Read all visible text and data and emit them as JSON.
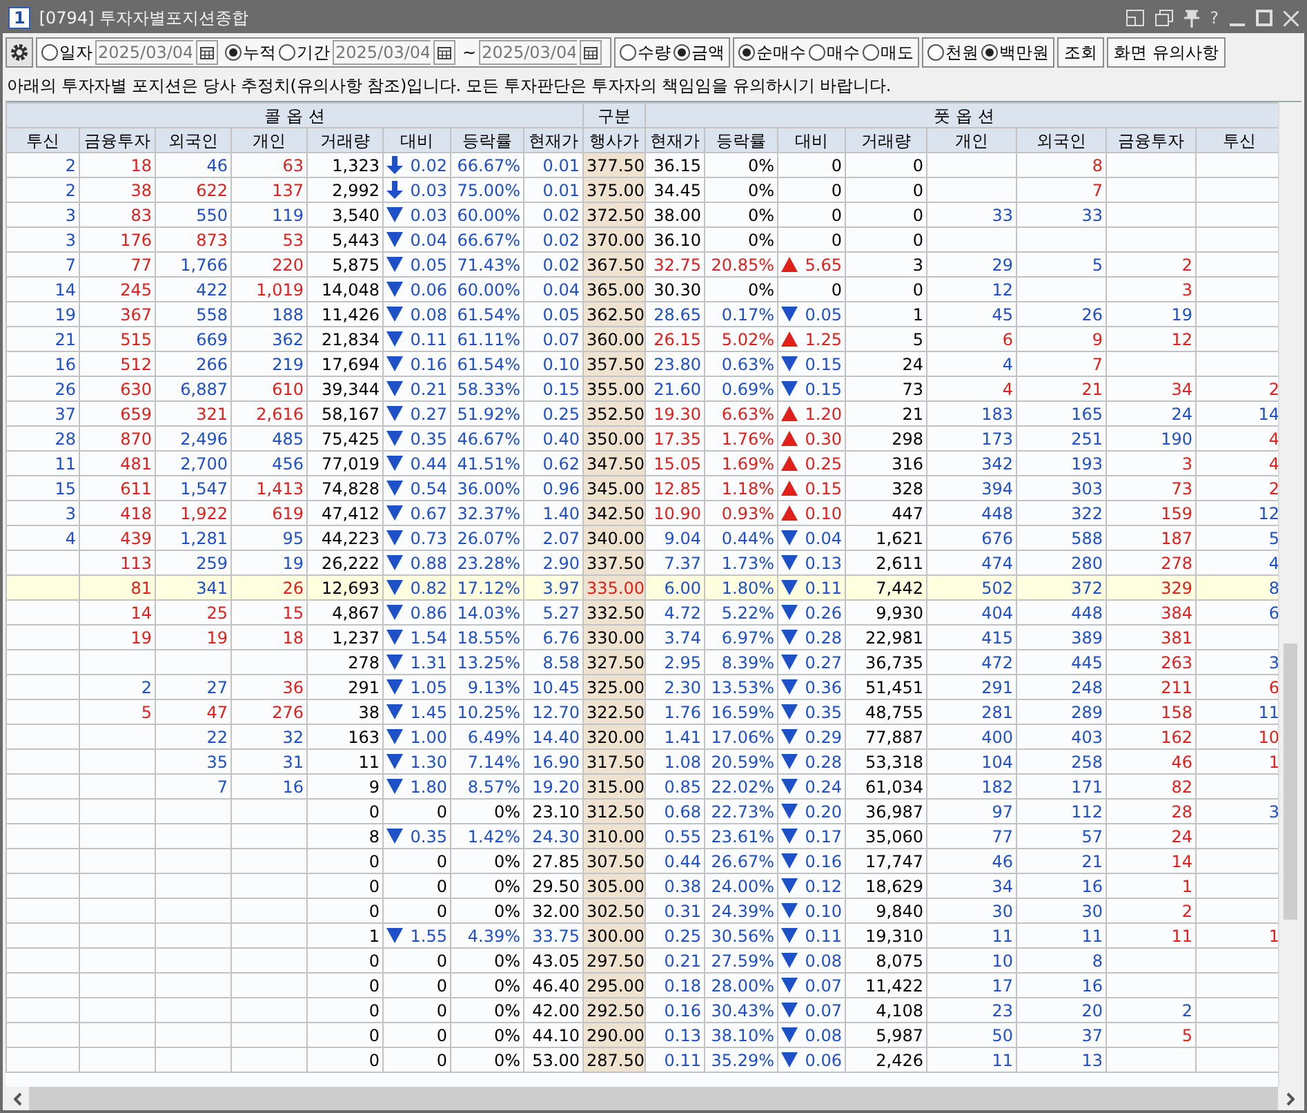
{
  "window": {
    "badge": "1",
    "title": "[0794] 투자자별포지션종합",
    "help": "?"
  },
  "toolbar": {
    "groups": [
      {
        "items": [
          {
            "kind": "radio",
            "label": "일자",
            "selected": false
          },
          {
            "kind": "date",
            "value": "2025/03/04"
          },
          {
            "kind": "radio",
            "label": "누적",
            "selected": true
          },
          {
            "kind": "radio",
            "label": "기간",
            "selected": false
          },
          {
            "kind": "date",
            "value": "2025/03/04"
          },
          {
            "kind": "text",
            "label": "~"
          },
          {
            "kind": "date",
            "value": "2025/03/04"
          }
        ]
      },
      {
        "items": [
          {
            "kind": "radio",
            "label": "수량",
            "selected": false
          },
          {
            "kind": "radio",
            "label": "금액",
            "selected": true
          }
        ]
      },
      {
        "items": [
          {
            "kind": "radio",
            "label": "순매수",
            "selected": true
          },
          {
            "kind": "radio",
            "label": "매수",
            "selected": false
          },
          {
            "kind": "radio",
            "label": "매도",
            "selected": false
          }
        ]
      },
      {
        "items": [
          {
            "kind": "radio",
            "label": "천원",
            "selected": false
          },
          {
            "kind": "radio",
            "label": "백만원",
            "selected": true
          }
        ]
      }
    ],
    "buttons": [
      "조회",
      "화면 유의사항"
    ]
  },
  "notice": "아래의 투자자별 포지션은 당사 추정치(유의사항 참조)입니다. 모든 투자판단은 투자자의 책임임을 유의하시기 바랍니다.",
  "table": {
    "groups": [
      "콜 옵 션",
      "구분",
      "풋 옵 션"
    ],
    "call_columns": [
      "투신",
      "금융투자",
      "외국인",
      "개인",
      "거래량",
      "대비",
      "등락률",
      "현재가"
    ],
    "strike_column": "행사가",
    "put_columns": [
      "현재가",
      "등락률",
      "대비",
      "거래량",
      "개인",
      "외국인",
      "금융투자",
      "투신"
    ],
    "rows": [
      {
        "strike": "377.50",
        "selected": false,
        "call": {
          "inv_trust": {
            "text": "2",
            "net_buy": false
          },
          "fin_invest": {
            "text": "18",
            "net_buy": true
          },
          "foreign": {
            "text": "46",
            "net_buy": false
          },
          "individual": {
            "text": "63",
            "net_buy": true
          },
          "volume": "1,323",
          "change": {
            "text": "0.02",
            "kind": "limit_down"
          },
          "change_rate": "66.67%",
          "price": "0.01"
        },
        "put": {
          "price": "36.15",
          "change_rate": "0%",
          "change": {
            "text": "0",
            "kind": "flat"
          },
          "volume": "0",
          "foreign": {
            "text": "8",
            "net_buy": true
          }
        }
      },
      {
        "strike": "375.00",
        "selected": false,
        "call": {
          "inv_trust": {
            "text": "2",
            "net_buy": false
          },
          "fin_invest": {
            "text": "38",
            "net_buy": true
          },
          "foreign": {
            "text": "622",
            "net_buy": true
          },
          "individual": {
            "text": "137",
            "net_buy": true
          },
          "volume": "2,992",
          "change": {
            "text": "0.03",
            "kind": "limit_down"
          },
          "change_rate": "75.00%",
          "price": "0.01"
        },
        "put": {
          "price": "34.45",
          "change_rate": "0%",
          "change": {
            "text": "0",
            "kind": "flat"
          },
          "volume": "0",
          "foreign": {
            "text": "7",
            "net_buy": true
          }
        }
      },
      {
        "strike": "372.50",
        "selected": false,
        "call": {
          "inv_trust": {
            "text": "3",
            "net_buy": false
          },
          "fin_invest": {
            "text": "83",
            "net_buy": true
          },
          "foreign": {
            "text": "550",
            "net_buy": false
          },
          "individual": {
            "text": "119",
            "net_buy": false
          },
          "volume": "3,540",
          "change": {
            "text": "0.03",
            "kind": "down"
          },
          "change_rate": "60.00%",
          "price": "0.02"
        },
        "put": {
          "price": "38.00",
          "change_rate": "0%",
          "change": {
            "text": "0",
            "kind": "flat"
          },
          "volume": "0",
          "individual": {
            "text": "33",
            "net_buy": false
          },
          "foreign": {
            "text": "33",
            "net_buy": false
          }
        }
      },
      {
        "strike": "370.00",
        "selected": false,
        "call": {
          "inv_trust": {
            "text": "3",
            "net_buy": false
          },
          "fin_invest": {
            "text": "176",
            "net_buy": true
          },
          "foreign": {
            "text": "873",
            "net_buy": true
          },
          "individual": {
            "text": "53",
            "net_buy": true
          },
          "volume": "5,443",
          "change": {
            "text": "0.04",
            "kind": "down"
          },
          "change_rate": "66.67%",
          "price": "0.02"
        },
        "put": {
          "price": "36.10",
          "change_rate": "0%",
          "change": {
            "text": "0",
            "kind": "flat"
          },
          "volume": "0"
        }
      },
      {
        "strike": "367.50",
        "selected": false,
        "call": {
          "inv_trust": {
            "text": "7",
            "net_buy": false
          },
          "fin_invest": {
            "text": "77",
            "net_buy": true
          },
          "foreign": {
            "text": "1,766",
            "net_buy": false
          },
          "individual": {
            "text": "220",
            "net_buy": true
          },
          "volume": "5,875",
          "change": {
            "text": "0.05",
            "kind": "down"
          },
          "change_rate": "71.43%",
          "price": "0.02"
        },
        "put": {
          "price": "32.75",
          "change_rate": "20.85%",
          "change": {
            "text": "5.65",
            "kind": "up"
          },
          "volume": "3",
          "individual": {
            "text": "29",
            "net_buy": false
          },
          "foreign": {
            "text": "5",
            "net_buy": false
          },
          "fin_invest": {
            "text": "2",
            "net_buy": true
          }
        }
      },
      {
        "strike": "365.00",
        "selected": false,
        "call": {
          "inv_trust": {
            "text": "14",
            "net_buy": false
          },
          "fin_invest": {
            "text": "245",
            "net_buy": true
          },
          "foreign": {
            "text": "422",
            "net_buy": false
          },
          "individual": {
            "text": "1,019",
            "net_buy": true
          },
          "volume": "14,048",
          "change": {
            "text": "0.06",
            "kind": "down"
          },
          "change_rate": "60.00%",
          "price": "0.04"
        },
        "put": {
          "price": "30.30",
          "change_rate": "0%",
          "change": {
            "text": "0",
            "kind": "flat"
          },
          "volume": "0",
          "individual": {
            "text": "12",
            "net_buy": false
          },
          "fin_invest": {
            "text": "3",
            "net_buy": true
          }
        }
      },
      {
        "strike": "362.50",
        "selected": false,
        "call": {
          "inv_trust": {
            "text": "19",
            "net_buy": false
          },
          "fin_invest": {
            "text": "367",
            "net_buy": true
          },
          "foreign": {
            "text": "558",
            "net_buy": false
          },
          "individual": {
            "text": "188",
            "net_buy": false
          },
          "volume": "11,426",
          "change": {
            "text": "0.08",
            "kind": "down"
          },
          "change_rate": "61.54%",
          "price": "0.05"
        },
        "put": {
          "price": "28.65",
          "change_rate": "0.17%",
          "change": {
            "text": "0.05",
            "kind": "down"
          },
          "volume": "1",
          "individual": {
            "text": "45",
            "net_buy": false
          },
          "foreign": {
            "text": "26",
            "net_buy": false
          },
          "fin_invest": {
            "text": "19",
            "net_buy": false
          }
        }
      },
      {
        "strike": "360.00",
        "selected": false,
        "call": {
          "inv_trust": {
            "text": "21",
            "net_buy": false
          },
          "fin_invest": {
            "text": "515",
            "net_buy": true
          },
          "foreign": {
            "text": "669",
            "net_buy": false
          },
          "individual": {
            "text": "362",
            "net_buy": false
          },
          "volume": "21,834",
          "change": {
            "text": "0.11",
            "kind": "down"
          },
          "change_rate": "61.11%",
          "price": "0.07"
        },
        "put": {
          "price": "26.15",
          "change_rate": "5.02%",
          "change": {
            "text": "1.25",
            "kind": "up"
          },
          "volume": "5",
          "individual": {
            "text": "6",
            "net_buy": true
          },
          "foreign": {
            "text": "9",
            "net_buy": true
          },
          "fin_invest": {
            "text": "12",
            "net_buy": true
          }
        }
      },
      {
        "strike": "357.50",
        "selected": false,
        "call": {
          "inv_trust": {
            "text": "16",
            "net_buy": false
          },
          "fin_invest": {
            "text": "512",
            "net_buy": true
          },
          "foreign": {
            "text": "266",
            "net_buy": false
          },
          "individual": {
            "text": "219",
            "net_buy": false
          },
          "volume": "17,694",
          "change": {
            "text": "0.16",
            "kind": "down"
          },
          "change_rate": "61.54%",
          "price": "0.10"
        },
        "put": {
          "price": "23.80",
          "change_rate": "0.63%",
          "change": {
            "text": "0.15",
            "kind": "down"
          },
          "volume": "24",
          "individual": {
            "text": "4",
            "net_buy": false
          },
          "foreign": {
            "text": "7",
            "net_buy": true
          }
        }
      },
      {
        "strike": "355.00",
        "selected": false,
        "call": {
          "inv_trust": {
            "text": "26",
            "net_buy": false
          },
          "fin_invest": {
            "text": "630",
            "net_buy": true
          },
          "foreign": {
            "text": "6,887",
            "net_buy": false
          },
          "individual": {
            "text": "610",
            "net_buy": true
          },
          "volume": "39,344",
          "change": {
            "text": "0.21",
            "kind": "down"
          },
          "change_rate": "58.33%",
          "price": "0.15"
        },
        "put": {
          "price": "21.60",
          "change_rate": "0.69%",
          "change": {
            "text": "0.15",
            "kind": "down"
          },
          "volume": "73",
          "individual": {
            "text": "4",
            "net_buy": true
          },
          "foreign": {
            "text": "21",
            "net_buy": true
          },
          "fin_invest": {
            "text": "34",
            "net_buy": true
          },
          "inv_trust": {
            "text": "2",
            "net_buy": true
          }
        }
      },
      {
        "strike": "352.50",
        "selected": false,
        "call": {
          "inv_trust": {
            "text": "37",
            "net_buy": false
          },
          "fin_invest": {
            "text": "659",
            "net_buy": true
          },
          "foreign": {
            "text": "321",
            "net_buy": true
          },
          "individual": {
            "text": "2,616",
            "net_buy": true
          },
          "volume": "58,167",
          "change": {
            "text": "0.27",
            "kind": "down"
          },
          "change_rate": "51.92%",
          "price": "0.25"
        },
        "put": {
          "price": "19.30",
          "change_rate": "6.63%",
          "change": {
            "text": "1.20",
            "kind": "up"
          },
          "volume": "21",
          "individual": {
            "text": "183",
            "net_buy": false
          },
          "foreign": {
            "text": "165",
            "net_buy": false
          },
          "fin_invest": {
            "text": "24",
            "net_buy": false
          },
          "inv_trust": {
            "text": "14",
            "net_buy": false
          }
        }
      },
      {
        "strike": "350.00",
        "selected": false,
        "call": {
          "inv_trust": {
            "text": "28",
            "net_buy": false
          },
          "fin_invest": {
            "text": "870",
            "net_buy": true
          },
          "foreign": {
            "text": "2,496",
            "net_buy": false
          },
          "individual": {
            "text": "485",
            "net_buy": false
          },
          "volume": "75,425",
          "change": {
            "text": "0.35",
            "kind": "down"
          },
          "change_rate": "46.67%",
          "price": "0.40"
        },
        "put": {
          "price": "17.35",
          "change_rate": "1.76%",
          "change": {
            "text": "0.30",
            "kind": "up"
          },
          "volume": "298",
          "individual": {
            "text": "173",
            "net_buy": false
          },
          "foreign": {
            "text": "251",
            "net_buy": false
          },
          "fin_invest": {
            "text": "190",
            "net_buy": false
          },
          "inv_trust": {
            "text": "4",
            "net_buy": true
          }
        }
      },
      {
        "strike": "347.50",
        "selected": false,
        "call": {
          "inv_trust": {
            "text": "11",
            "net_buy": false
          },
          "fin_invest": {
            "text": "481",
            "net_buy": true
          },
          "foreign": {
            "text": "2,700",
            "net_buy": false
          },
          "individual": {
            "text": "456",
            "net_buy": false
          },
          "volume": "77,019",
          "change": {
            "text": "0.44",
            "kind": "down"
          },
          "change_rate": "41.51%",
          "price": "0.62"
        },
        "put": {
          "price": "15.05",
          "change_rate": "1.69%",
          "change": {
            "text": "0.25",
            "kind": "up"
          },
          "volume": "316",
          "individual": {
            "text": "342",
            "net_buy": false
          },
          "foreign": {
            "text": "193",
            "net_buy": false
          },
          "fin_invest": {
            "text": "3",
            "net_buy": true
          },
          "inv_trust": {
            "text": "4",
            "net_buy": true
          }
        }
      },
      {
        "strike": "345.00",
        "selected": false,
        "call": {
          "inv_trust": {
            "text": "15",
            "net_buy": false
          },
          "fin_invest": {
            "text": "611",
            "net_buy": true
          },
          "foreign": {
            "text": "1,547",
            "net_buy": false
          },
          "individual": {
            "text": "1,413",
            "net_buy": true
          },
          "volume": "74,828",
          "change": {
            "text": "0.54",
            "kind": "down"
          },
          "change_rate": "36.00%",
          "price": "0.96"
        },
        "put": {
          "price": "12.85",
          "change_rate": "1.18%",
          "change": {
            "text": "0.15",
            "kind": "up"
          },
          "volume": "328",
          "individual": {
            "text": "394",
            "net_buy": false
          },
          "foreign": {
            "text": "303",
            "net_buy": false
          },
          "fin_invest": {
            "text": "73",
            "net_buy": true
          },
          "inv_trust": {
            "text": "2",
            "net_buy": true
          }
        }
      },
      {
        "strike": "342.50",
        "selected": false,
        "call": {
          "inv_trust": {
            "text": "3",
            "net_buy": false
          },
          "fin_invest": {
            "text": "418",
            "net_buy": true
          },
          "foreign": {
            "text": "1,922",
            "net_buy": true
          },
          "individual": {
            "text": "619",
            "net_buy": true
          },
          "volume": "47,412",
          "change": {
            "text": "0.67",
            "kind": "down"
          },
          "change_rate": "32.37%",
          "price": "1.40"
        },
        "put": {
          "price": "10.90",
          "change_rate": "0.93%",
          "change": {
            "text": "0.10",
            "kind": "up"
          },
          "volume": "447",
          "individual": {
            "text": "448",
            "net_buy": false
          },
          "foreign": {
            "text": "322",
            "net_buy": false
          },
          "fin_invest": {
            "text": "159",
            "net_buy": true
          },
          "inv_trust": {
            "text": "12",
            "net_buy": false
          }
        }
      },
      {
        "strike": "340.00",
        "selected": false,
        "call": {
          "inv_trust": {
            "text": "4",
            "net_buy": false
          },
          "fin_invest": {
            "text": "439",
            "net_buy": true
          },
          "foreign": {
            "text": "1,281",
            "net_buy": false
          },
          "individual": {
            "text": "95",
            "net_buy": false
          },
          "volume": "44,223",
          "change": {
            "text": "0.73",
            "kind": "down"
          },
          "change_rate": "26.07%",
          "price": "2.07"
        },
        "put": {
          "price": "9.04",
          "change_rate": "0.44%",
          "change": {
            "text": "0.04",
            "kind": "down"
          },
          "volume": "1,621",
          "individual": {
            "text": "676",
            "net_buy": false
          },
          "foreign": {
            "text": "588",
            "net_buy": false
          },
          "fin_invest": {
            "text": "187",
            "net_buy": true
          },
          "inv_trust": {
            "text": "5",
            "net_buy": false
          }
        }
      },
      {
        "strike": "337.50",
        "selected": false,
        "call": {
          "fin_invest": {
            "text": "113",
            "net_buy": true
          },
          "foreign": {
            "text": "259",
            "net_buy": false
          },
          "individual": {
            "text": "19",
            "net_buy": false
          },
          "volume": "26,222",
          "change": {
            "text": "0.88",
            "kind": "down"
          },
          "change_rate": "23.28%",
          "price": "2.90"
        },
        "put": {
          "price": "7.37",
          "change_rate": "1.73%",
          "change": {
            "text": "0.13",
            "kind": "down"
          },
          "volume": "2,611",
          "individual": {
            "text": "474",
            "net_buy": false
          },
          "foreign": {
            "text": "280",
            "net_buy": false
          },
          "fin_invest": {
            "text": "278",
            "net_buy": true
          },
          "inv_trust": {
            "text": "4",
            "net_buy": false
          }
        }
      },
      {
        "strike": "335.00",
        "selected": true,
        "call": {
          "fin_invest": {
            "text": "81",
            "net_buy": true
          },
          "foreign": {
            "text": "341",
            "net_buy": false
          },
          "individual": {
            "text": "26",
            "net_buy": true
          },
          "volume": "12,693",
          "change": {
            "text": "0.82",
            "kind": "down"
          },
          "change_rate": "17.12%",
          "price": "3.97"
        },
        "put": {
          "price": "6.00",
          "change_rate": "1.80%",
          "change": {
            "text": "0.11",
            "kind": "down"
          },
          "volume": "7,442",
          "individual": {
            "text": "502",
            "net_buy": false
          },
          "foreign": {
            "text": "372",
            "net_buy": false
          },
          "fin_invest": {
            "text": "329",
            "net_buy": true
          },
          "inv_trust": {
            "text": "8",
            "net_buy": false
          }
        }
      },
      {
        "strike": "332.50",
        "selected": false,
        "call": {
          "fin_invest": {
            "text": "14",
            "net_buy": true
          },
          "foreign": {
            "text": "25",
            "net_buy": true
          },
          "individual": {
            "text": "15",
            "net_buy": true
          },
          "volume": "4,867",
          "change": {
            "text": "0.86",
            "kind": "down"
          },
          "change_rate": "14.03%",
          "price": "5.27"
        },
        "put": {
          "price": "4.72",
          "change_rate": "5.22%",
          "change": {
            "text": "0.26",
            "kind": "down"
          },
          "volume": "9,930",
          "individual": {
            "text": "404",
            "net_buy": false
          },
          "foreign": {
            "text": "448",
            "net_buy": false
          },
          "fin_invest": {
            "text": "384",
            "net_buy": true
          },
          "inv_trust": {
            "text": "6",
            "net_buy": false
          }
        }
      },
      {
        "strike": "330.00",
        "selected": false,
        "call": {
          "fin_invest": {
            "text": "19",
            "net_buy": true
          },
          "foreign": {
            "text": "19",
            "net_buy": true
          },
          "individual": {
            "text": "18",
            "net_buy": true
          },
          "volume": "1,237",
          "change": {
            "text": "1.54",
            "kind": "down"
          },
          "change_rate": "18.55%",
          "price": "6.76"
        },
        "put": {
          "price": "3.74",
          "change_rate": "6.97%",
          "change": {
            "text": "0.28",
            "kind": "down"
          },
          "volume": "22,981",
          "individual": {
            "text": "415",
            "net_buy": false
          },
          "foreign": {
            "text": "389",
            "net_buy": false
          },
          "fin_invest": {
            "text": "381",
            "net_buy": true
          }
        }
      },
      {
        "strike": "327.50",
        "selected": false,
        "call": {
          "volume": "278",
          "change": {
            "text": "1.31",
            "kind": "down"
          },
          "change_rate": "13.25%",
          "price": "8.58"
        },
        "put": {
          "price": "2.95",
          "change_rate": "8.39%",
          "change": {
            "text": "0.27",
            "kind": "down"
          },
          "volume": "36,735",
          "individual": {
            "text": "472",
            "net_buy": false
          },
          "foreign": {
            "text": "445",
            "net_buy": false
          },
          "fin_invest": {
            "text": "263",
            "net_buy": true
          },
          "inv_trust": {
            "text": "3",
            "net_buy": false
          }
        }
      },
      {
        "strike": "325.00",
        "selected": false,
        "call": {
          "fin_invest": {
            "text": "2",
            "net_buy": false
          },
          "foreign": {
            "text": "27",
            "net_buy": false
          },
          "individual": {
            "text": "36",
            "net_buy": true
          },
          "volume": "291",
          "change": {
            "text": "1.05",
            "kind": "down"
          },
          "change_rate": "9.13%",
          "price": "10.45"
        },
        "put": {
          "price": "2.30",
          "change_rate": "13.53%",
          "change": {
            "text": "0.36",
            "kind": "down"
          },
          "volume": "51,451",
          "individual": {
            "text": "291",
            "net_buy": false
          },
          "foreign": {
            "text": "248",
            "net_buy": false
          },
          "fin_invest": {
            "text": "211",
            "net_buy": true
          },
          "inv_trust": {
            "text": "6",
            "net_buy": true
          }
        }
      },
      {
        "strike": "322.50",
        "selected": false,
        "call": {
          "fin_invest": {
            "text": "5",
            "net_buy": true
          },
          "foreign": {
            "text": "47",
            "net_buy": true
          },
          "individual": {
            "text": "276",
            "net_buy": true
          },
          "volume": "38",
          "change": {
            "text": "1.45",
            "kind": "down"
          },
          "change_rate": "10.25%",
          "price": "12.70"
        },
        "put": {
          "price": "1.76",
          "change_rate": "16.59%",
          "change": {
            "text": "0.35",
            "kind": "down"
          },
          "volume": "48,755",
          "individual": {
            "text": "281",
            "net_buy": false
          },
          "foreign": {
            "text": "289",
            "net_buy": false
          },
          "fin_invest": {
            "text": "158",
            "net_buy": true
          },
          "inv_trust": {
            "text": "11",
            "net_buy": false
          }
        }
      },
      {
        "strike": "320.00",
        "selected": false,
        "call": {
          "foreign": {
            "text": "22",
            "net_buy": false
          },
          "individual": {
            "text": "32",
            "net_buy": false
          },
          "volume": "163",
          "change": {
            "text": "1.00",
            "kind": "down"
          },
          "change_rate": "6.49%",
          "price": "14.40"
        },
        "put": {
          "price": "1.41",
          "change_rate": "17.06%",
          "change": {
            "text": "0.29",
            "kind": "down"
          },
          "volume": "77,887",
          "individual": {
            "text": "400",
            "net_buy": false
          },
          "foreign": {
            "text": "403",
            "net_buy": false
          },
          "fin_invest": {
            "text": "162",
            "net_buy": true
          },
          "inv_trust": {
            "text": "10",
            "net_buy": true
          }
        }
      },
      {
        "strike": "317.50",
        "selected": false,
        "call": {
          "foreign": {
            "text": "35",
            "net_buy": false
          },
          "individual": {
            "text": "31",
            "net_buy": false
          },
          "volume": "11",
          "change": {
            "text": "1.30",
            "kind": "down"
          },
          "change_rate": "7.14%",
          "price": "16.90"
        },
        "put": {
          "price": "1.08",
          "change_rate": "20.59%",
          "change": {
            "text": "0.28",
            "kind": "down"
          },
          "volume": "53,318",
          "individual": {
            "text": "104",
            "net_buy": false
          },
          "foreign": {
            "text": "258",
            "net_buy": false
          },
          "fin_invest": {
            "text": "46",
            "net_buy": true
          },
          "inv_trust": {
            "text": "1",
            "net_buy": true
          }
        }
      },
      {
        "strike": "315.00",
        "selected": false,
        "call": {
          "foreign": {
            "text": "7",
            "net_buy": false
          },
          "individual": {
            "text": "16",
            "net_buy": false
          },
          "volume": "9",
          "change": {
            "text": "1.80",
            "kind": "down"
          },
          "change_rate": "8.57%",
          "price": "19.20"
        },
        "put": {
          "price": "0.85",
          "change_rate": "22.02%",
          "change": {
            "text": "0.24",
            "kind": "down"
          },
          "volume": "61,034",
          "individual": {
            "text": "182",
            "net_buy": false
          },
          "foreign": {
            "text": "171",
            "net_buy": false
          },
          "fin_invest": {
            "text": "82",
            "net_buy": true
          }
        }
      },
      {
        "strike": "312.50",
        "selected": false,
        "call": {
          "volume": "0",
          "change": {
            "text": "0",
            "kind": "flat"
          },
          "change_rate": "0%",
          "price": "23.10"
        },
        "put": {
          "price": "0.68",
          "change_rate": "22.73%",
          "change": {
            "text": "0.20",
            "kind": "down"
          },
          "volume": "36,987",
          "individual": {
            "text": "97",
            "net_buy": false
          },
          "foreign": {
            "text": "112",
            "net_buy": false
          },
          "fin_invest": {
            "text": "28",
            "net_buy": true
          },
          "inv_trust": {
            "text": "3",
            "net_buy": false
          }
        }
      },
      {
        "strike": "310.00",
        "selected": false,
        "call": {
          "volume": "8",
          "change": {
            "text": "0.35",
            "kind": "down"
          },
          "change_rate": "1.42%",
          "price": "24.30"
        },
        "put": {
          "price": "0.55",
          "change_rate": "23.61%",
          "change": {
            "text": "0.17",
            "kind": "down"
          },
          "volume": "35,060",
          "individual": {
            "text": "77",
            "net_buy": false
          },
          "foreign": {
            "text": "57",
            "net_buy": false
          },
          "fin_invest": {
            "text": "24",
            "net_buy": true
          }
        }
      },
      {
        "strike": "307.50",
        "selected": false,
        "call": {
          "volume": "0",
          "change": {
            "text": "0",
            "kind": "flat"
          },
          "change_rate": "0%",
          "price": "27.85"
        },
        "put": {
          "price": "0.44",
          "change_rate": "26.67%",
          "change": {
            "text": "0.16",
            "kind": "down"
          },
          "volume": "17,747",
          "individual": {
            "text": "46",
            "net_buy": false
          },
          "foreign": {
            "text": "21",
            "net_buy": false
          },
          "fin_invest": {
            "text": "14",
            "net_buy": true
          }
        }
      },
      {
        "strike": "305.00",
        "selected": false,
        "call": {
          "volume": "0",
          "change": {
            "text": "0",
            "kind": "flat"
          },
          "change_rate": "0%",
          "price": "29.50"
        },
        "put": {
          "price": "0.38",
          "change_rate": "24.00%",
          "change": {
            "text": "0.12",
            "kind": "down"
          },
          "volume": "18,629",
          "individual": {
            "text": "34",
            "net_buy": false
          },
          "foreign": {
            "text": "16",
            "net_buy": false
          },
          "fin_invest": {
            "text": "1",
            "net_buy": true
          }
        }
      },
      {
        "strike": "302.50",
        "selected": false,
        "call": {
          "volume": "0",
          "change": {
            "text": "0",
            "kind": "flat"
          },
          "change_rate": "0%",
          "price": "32.00"
        },
        "put": {
          "price": "0.31",
          "change_rate": "24.39%",
          "change": {
            "text": "0.10",
            "kind": "down"
          },
          "volume": "9,840",
          "individual": {
            "text": "30",
            "net_buy": false
          },
          "foreign": {
            "text": "30",
            "net_buy": false
          },
          "fin_invest": {
            "text": "2",
            "net_buy": true
          }
        }
      },
      {
        "strike": "300.00",
        "selected": false,
        "call": {
          "volume": "1",
          "change": {
            "text": "1.55",
            "kind": "down"
          },
          "change_rate": "4.39%",
          "price": "33.75"
        },
        "put": {
          "price": "0.25",
          "change_rate": "30.56%",
          "change": {
            "text": "0.11",
            "kind": "down"
          },
          "volume": "19,310",
          "individual": {
            "text": "11",
            "net_buy": false
          },
          "foreign": {
            "text": "11",
            "net_buy": false
          },
          "fin_invest": {
            "text": "11",
            "net_buy": true
          },
          "inv_trust": {
            "text": "1",
            "net_buy": true
          }
        }
      },
      {
        "strike": "297.50",
        "selected": false,
        "call": {
          "volume": "0",
          "change": {
            "text": "0",
            "kind": "flat"
          },
          "change_rate": "0%",
          "price": "43.05"
        },
        "put": {
          "price": "0.21",
          "change_rate": "27.59%",
          "change": {
            "text": "0.08",
            "kind": "down"
          },
          "volume": "8,075",
          "individual": {
            "text": "10",
            "net_buy": false
          },
          "foreign": {
            "text": "8",
            "net_buy": false
          }
        }
      },
      {
        "strike": "295.00",
        "selected": false,
        "call": {
          "volume": "0",
          "change": {
            "text": "0",
            "kind": "flat"
          },
          "change_rate": "0%",
          "price": "46.40"
        },
        "put": {
          "price": "0.18",
          "change_rate": "28.00%",
          "change": {
            "text": "0.07",
            "kind": "down"
          },
          "volume": "11,422",
          "individual": {
            "text": "17",
            "net_buy": false
          },
          "foreign": {
            "text": "16",
            "net_buy": false
          }
        }
      },
      {
        "strike": "292.50",
        "selected": false,
        "call": {
          "volume": "0",
          "change": {
            "text": "0",
            "kind": "flat"
          },
          "change_rate": "0%",
          "price": "42.00"
        },
        "put": {
          "price": "0.16",
          "change_rate": "30.43%",
          "change": {
            "text": "0.07",
            "kind": "down"
          },
          "volume": "4,108",
          "individual": {
            "text": "23",
            "net_buy": false
          },
          "foreign": {
            "text": "20",
            "net_buy": false
          },
          "fin_invest": {
            "text": "2",
            "net_buy": false
          }
        }
      },
      {
        "strike": "290.00",
        "selected": false,
        "call": {
          "volume": "0",
          "change": {
            "text": "0",
            "kind": "flat"
          },
          "change_rate": "0%",
          "price": "44.10"
        },
        "put": {
          "price": "0.13",
          "change_rate": "38.10%",
          "change": {
            "text": "0.08",
            "kind": "down"
          },
          "volume": "5,987",
          "individual": {
            "text": "50",
            "net_buy": false
          },
          "foreign": {
            "text": "37",
            "net_buy": false
          },
          "fin_invest": {
            "text": "5",
            "net_buy": true
          }
        }
      },
      {
        "strike": "287.50",
        "selected": false,
        "call": {
          "volume": "0",
          "change": {
            "text": "0",
            "kind": "flat"
          },
          "change_rate": "0%",
          "price": "53.00"
        },
        "put": {
          "price": "0.11",
          "change_rate": "35.29%",
          "change": {
            "text": "0.06",
            "kind": "down"
          },
          "volume": "2,426",
          "individual": {
            "text": "11",
            "net_buy": false
          },
          "foreign": {
            "text": "13",
            "net_buy": false
          }
        }
      }
    ]
  }
}
